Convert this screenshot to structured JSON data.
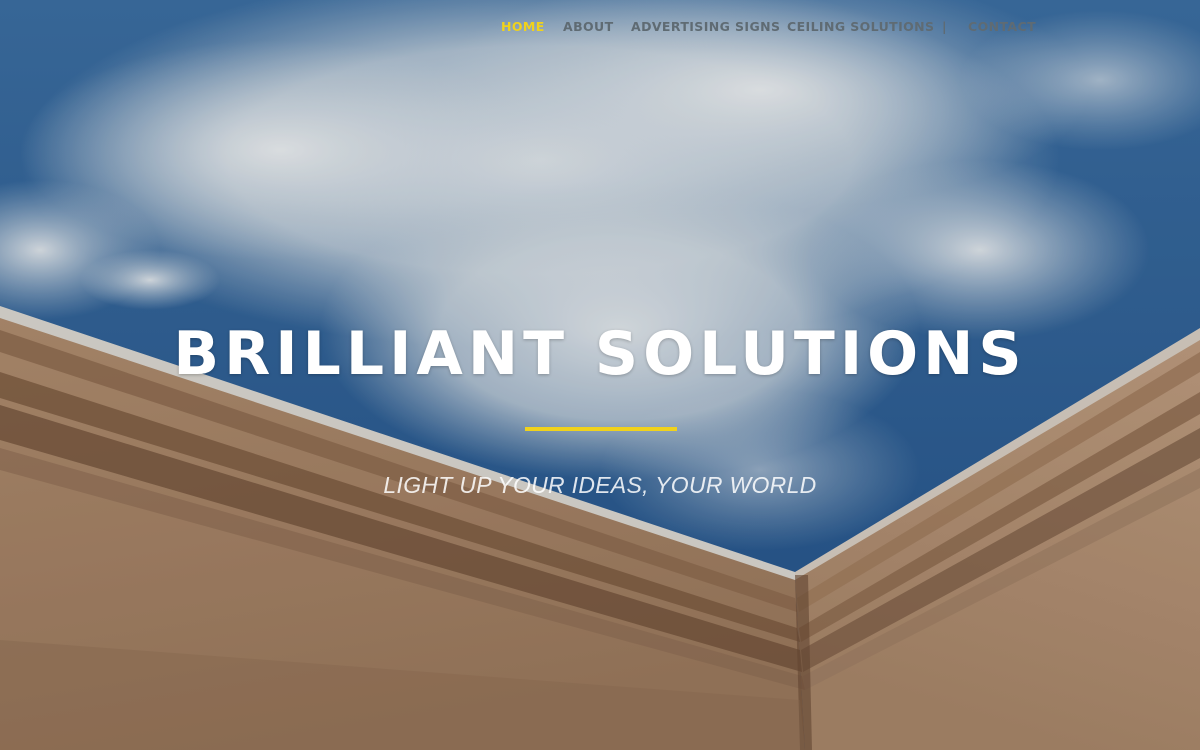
{
  "nav": {
    "items": [
      {
        "label": "HOME",
        "active": true
      },
      {
        "label": "ABOUT",
        "active": false
      },
      {
        "label": "ADVERTISING SIGNS",
        "active": false
      },
      {
        "label": "CEILING SOLUTIONS",
        "active": false
      },
      {
        "label": "CONTACT",
        "active": false
      }
    ],
    "separator": "|"
  },
  "hero": {
    "title": "BRILLIANT SOLUTIONS",
    "tagline": "LIGHT UP YOUR IDEAS, YOUR WORLD"
  },
  "colors": {
    "accent": "#f0d21c",
    "nav_text": "#5f6b73",
    "sky": "#2f5f93",
    "wall": "#a9876a"
  }
}
